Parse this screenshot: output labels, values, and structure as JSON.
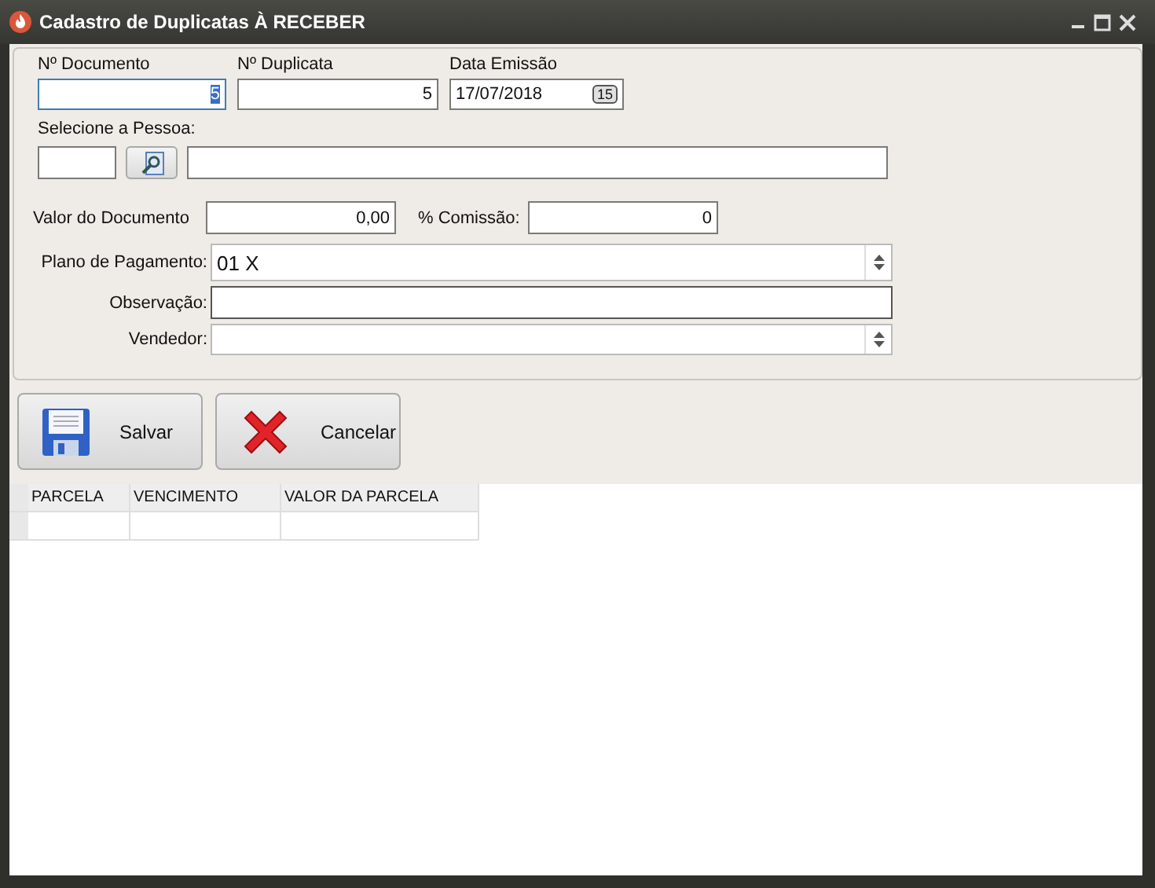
{
  "window": {
    "title": "Cadastro de Duplicatas À RECEBER"
  },
  "documento": {
    "label": "Nº Documento",
    "value": "5",
    "focused": true
  },
  "duplicata": {
    "label": "Nº Duplicata",
    "value": "5",
    "focused": false
  },
  "emissao": {
    "label": "Data Emissão",
    "value": "17/07/2018",
    "calendar": "15"
  },
  "pessoa": {
    "label": "Selecione a Pessoa:"
  },
  "valor": {
    "label": "Valor do Documento",
    "value": "0,00"
  },
  "comissao": {
    "label": "% Comissão:",
    "value": "0"
  },
  "rows": [
    {
      "kind": "select",
      "label": "Plano de Pagamento:",
      "value": "01 X"
    },
    {
      "kind": "text",
      "label": "Observação:",
      "value": ""
    },
    {
      "kind": "select",
      "label": "Vendedor:",
      "value": ""
    }
  ],
  "buttons": [
    {
      "kind": "save",
      "label": "Salvar"
    },
    {
      "kind": "cancel",
      "label": "Cancelar"
    }
  ],
  "table": {
    "columns": [
      "PARCELA",
      "VENCIMENTO",
      "VALOR DA PARCELA"
    ]
  }
}
